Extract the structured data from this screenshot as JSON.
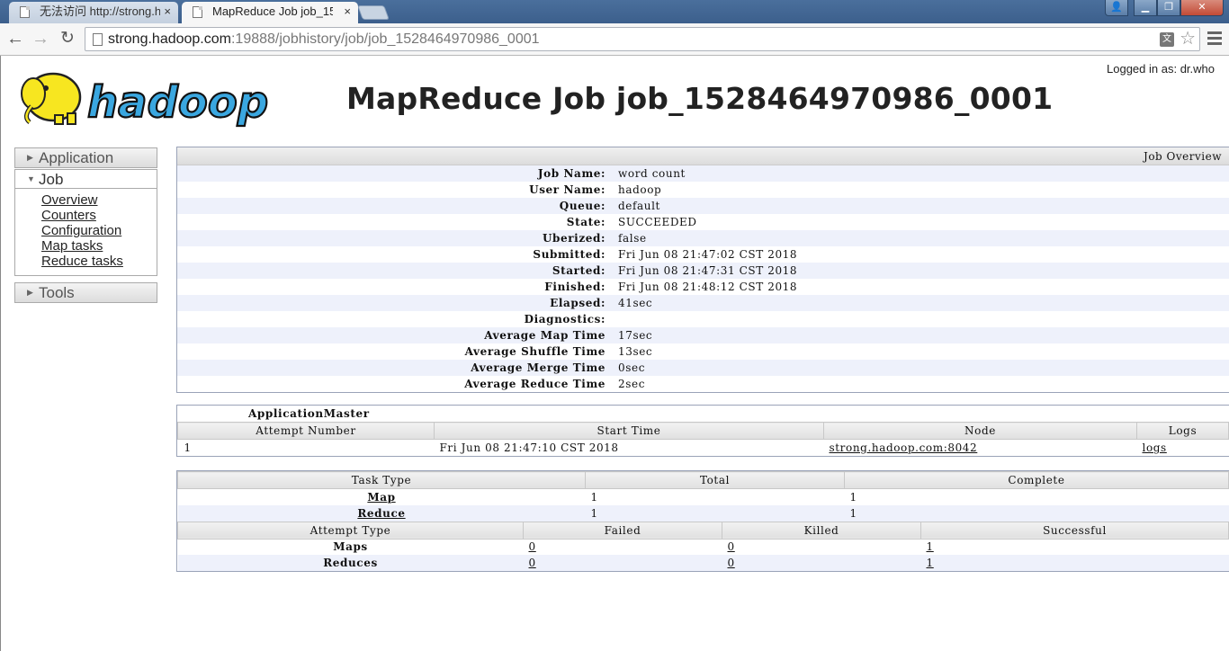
{
  "browser": {
    "tabs": [
      {
        "label": "无法访问 http://strong.h",
        "close": "×"
      },
      {
        "label": "MapReduce Job job_15...",
        "close": "×"
      }
    ],
    "url_host": "strong.hadoop.com",
    "url_rest": ":19888/jobhistory/job/job_1528464970986_0001"
  },
  "header": {
    "logged_in": "Logged in as: dr.who",
    "logo_text": "hadoop",
    "title": "MapReduce Job job_1528464970986_0001"
  },
  "sidebar": {
    "application": "Application",
    "job": "Job",
    "job_links": [
      "Overview",
      "Counters",
      "Configuration",
      "Map tasks",
      "Reduce tasks"
    ],
    "tools": "Tools"
  },
  "overview": {
    "heading": "Job Overview",
    "rows": [
      {
        "k": "Job Name:",
        "v": "word count"
      },
      {
        "k": "User Name:",
        "v": "hadoop"
      },
      {
        "k": "Queue:",
        "v": "default"
      },
      {
        "k": "State:",
        "v": "SUCCEEDED"
      },
      {
        "k": "Uberized:",
        "v": "false"
      },
      {
        "k": "Submitted:",
        "v": "Fri Jun 08 21:47:02 CST 2018"
      },
      {
        "k": "Started:",
        "v": "Fri Jun 08 21:47:31 CST 2018"
      },
      {
        "k": "Finished:",
        "v": "Fri Jun 08 21:48:12 CST 2018"
      },
      {
        "k": "Elapsed:",
        "v": "41sec"
      },
      {
        "k": "Diagnostics:",
        "v": ""
      },
      {
        "k": "Average Map Time",
        "v": "17sec"
      },
      {
        "k": "Average Shuffle Time",
        "v": "13sec"
      },
      {
        "k": "Average Merge Time",
        "v": "0sec"
      },
      {
        "k": "Average Reduce Time",
        "v": "2sec"
      }
    ]
  },
  "am": {
    "title": "ApplicationMaster",
    "headers": [
      "Attempt Number",
      "Start Time",
      "Node",
      "Logs"
    ],
    "row": {
      "attempt": "1",
      "start": "Fri Jun 08 21:47:10 CST 2018",
      "node": "strong.hadoop.com:8042",
      "logs": "logs"
    }
  },
  "tasks": {
    "headers": [
      "Task Type",
      "Total",
      "Complete"
    ],
    "rows": [
      {
        "type": "Map",
        "total": "1",
        "complete": "1"
      },
      {
        "type": "Reduce",
        "total": "1",
        "complete": "1"
      }
    ],
    "attempt_headers": [
      "Attempt Type",
      "Failed",
      "Killed",
      "Successful"
    ],
    "attempt_rows": [
      {
        "type": "Maps",
        "failed": "0",
        "killed": "0",
        "successful": "1"
      },
      {
        "type": "Reduces",
        "failed": "0",
        "killed": "0",
        "successful": "1"
      }
    ]
  }
}
